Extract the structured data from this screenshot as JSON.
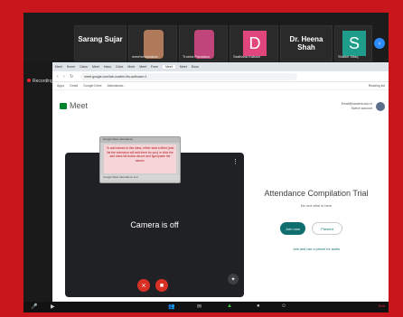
{
  "gallery": {
    "participants": [
      {
        "name": "Sarang Sujar",
        "type": "name-only"
      },
      {
        "name": "mechrovisaaksh",
        "type": "video"
      },
      {
        "name": "Trusha Pavaskar",
        "type": "video"
      },
      {
        "name": "Sadhana Kabaar",
        "type": "letter",
        "letter": "D",
        "color": "#e0457b"
      },
      {
        "name": "Dr. Heena Shah",
        "type": "name-only"
      },
      {
        "name": "Shaikh Sifaq",
        "type": "letter",
        "letter": "S",
        "color": "#1e9e8a"
      }
    ],
    "next_icon": "chevron-right-icon"
  },
  "recording": {
    "label": "Recording"
  },
  "browser": {
    "tabs": [
      "Meet",
      "Home",
      "Class",
      "Meet",
      "Inbox",
      "Drive",
      "Meet",
      "Meet",
      "Form",
      "Meet",
      "Meet",
      "Docs"
    ],
    "url": "meet.google.com/lab-onwkln-hfu-authuser=1",
    "bookmarks": [
      "Apps",
      "Gmail",
      "Google Drive",
      "Attendance..."
    ],
    "reading_list": "Reading list"
  },
  "meet": {
    "logo": "Meet",
    "account_email": "Email@student.edu.in",
    "account_switch": "Switch account",
    "camera_status": "Camera is off",
    "popup_title": "Google Meet Attendance",
    "popup_message": "To add names to this class, either start a Meet (and list the extension will add them for you) or click the add class list button above and type/paste the names.",
    "popup_footer": "Google Meet Attendance List",
    "meeting_title": "Attendance Compilation Trial",
    "status": "No one else is here",
    "join_label": "Join now",
    "present_label": "Present",
    "phone_label": "Join and use a phone for audio"
  },
  "toolbar": {
    "zoom_tab": "End"
  },
  "colors": {
    "accent": "#0f6e6e",
    "border": "#c8161c"
  }
}
